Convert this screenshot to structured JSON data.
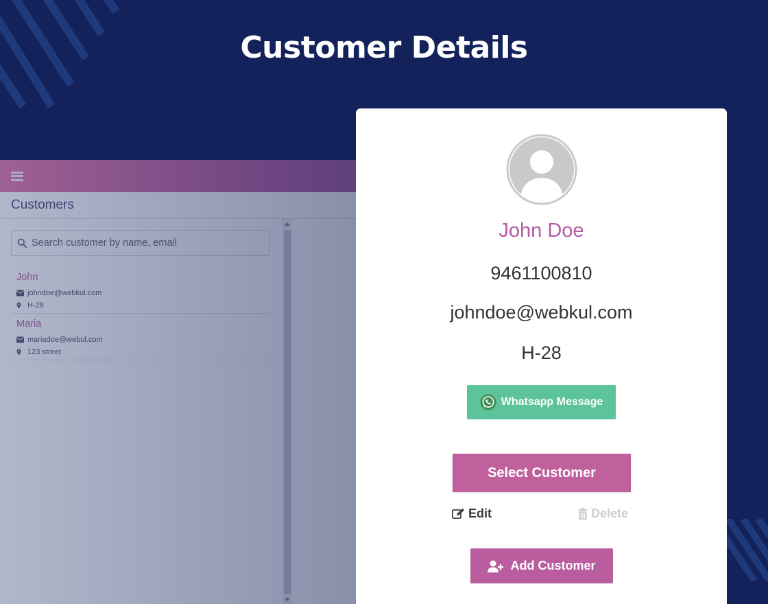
{
  "page": {
    "title": "Customer Details"
  },
  "app": {
    "heading": "Customers",
    "search": {
      "placeholder": "Search customer by name, email",
      "value": ""
    },
    "customers": [
      {
        "name": "John",
        "email": "johndoe@webkul.com",
        "address": "H-28"
      },
      {
        "name": "Maria",
        "email": "mariadoe@webul.com",
        "address": "123 street"
      }
    ]
  },
  "details": {
    "name": "John Doe",
    "phone": "9461100810",
    "email": "johndoe@webkul.com",
    "address": "H-28",
    "whatsapp_label": "Whatsapp Message",
    "select_label": "Select Customer",
    "edit_label": "Edit",
    "delete_label": "Delete",
    "add_label": "Add Customer"
  },
  "icons": {
    "menu": "hamburger-icon",
    "search": "search-icon",
    "email": "envelope-icon",
    "address": "map-marker-icon",
    "avatar": "user-avatar-icon",
    "whatsapp": "whatsapp-icon",
    "edit": "edit-icon",
    "delete": "trash-icon",
    "add": "user-plus-icon"
  },
  "colors": {
    "background": "#13225a",
    "topbar_start": "#e06aa2",
    "topbar_end": "#a24e94",
    "accent": "#c0609c",
    "name": "#b65aa2",
    "whatsapp": "#5cc39a",
    "delete_disabled": "#cfcfcf"
  }
}
